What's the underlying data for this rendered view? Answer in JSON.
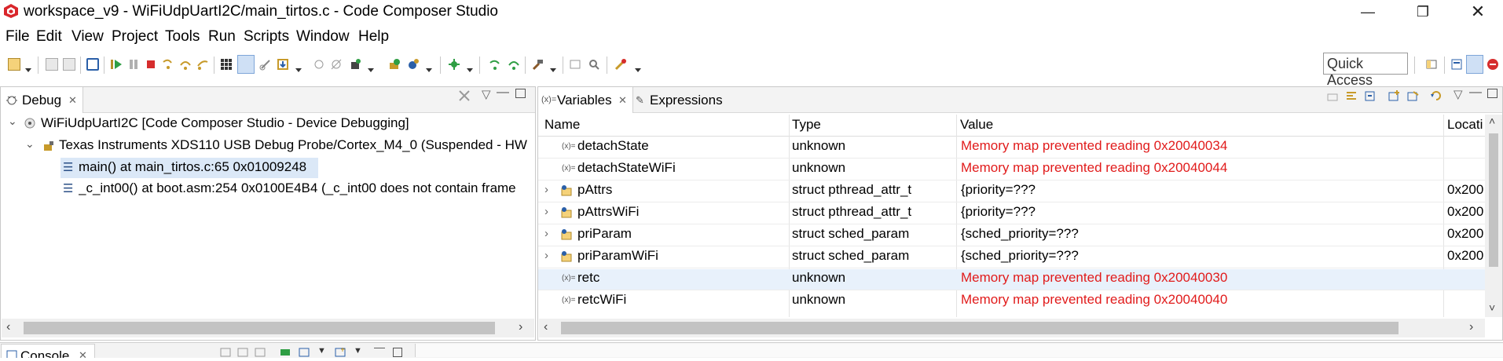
{
  "window": {
    "title": "workspace_v9 - WiFiUdpUartI2C/main_tirtos.c - Code Composer Studio"
  },
  "menu": [
    "File",
    "Edit",
    "View",
    "Project",
    "Tools",
    "Run",
    "Scripts",
    "Window",
    "Help"
  ],
  "toolbar": {
    "quick_access": "Quick Access"
  },
  "debug_view": {
    "tab_label": "Debug",
    "tree": [
      {
        "label": "WiFiUdpUartI2C [Code Composer Studio - Device Debugging]"
      },
      {
        "label": "Texas Instruments XDS110 USB Debug Probe/Cortex_M4_0 (Suspended - HW"
      },
      {
        "label": "main() at main_tirtos.c:65 0x01009248"
      },
      {
        "label": "_c_int00() at boot.asm:254 0x0100E4B4  (_c_int00 does not contain frame"
      }
    ]
  },
  "variables_view": {
    "tab_label": "Variables",
    "other_tab_label": "Expressions",
    "columns": [
      "Name",
      "Type",
      "Value",
      "Locati"
    ],
    "rows": [
      {
        "name": "detachState",
        "type": "unknown",
        "value": "Memory map prevented reading 0x20040034",
        "location": ""
      },
      {
        "name": "detachStateWiFi",
        "type": "unknown",
        "value": "Memory map prevented reading 0x20040044",
        "location": ""
      },
      {
        "name": "pAttrs",
        "type": "struct pthread_attr_t",
        "value": "{priority=???",
        "location": "0x200"
      },
      {
        "name": "pAttrsWiFi",
        "type": "struct pthread_attr_t",
        "value": "{priority=???",
        "location": "0x200"
      },
      {
        "name": "priParam",
        "type": "struct sched_param",
        "value": "{sched_priority=???",
        "location": "0x200"
      },
      {
        "name": "priParamWiFi",
        "type": "struct sched_param",
        "value": "{sched_priority=???",
        "location": "0x200"
      },
      {
        "name": "retc",
        "type": "unknown",
        "value": "Memory map prevented reading 0x20040030",
        "location": ""
      },
      {
        "name": "retcWiFi",
        "type": "unknown",
        "value": "Memory map prevented reading 0x20040040",
        "location": ""
      }
    ]
  },
  "console_view": {
    "tab_label": "Console"
  },
  "colors": {
    "error_text": "#e11b1b",
    "selection": "#dbe8f7",
    "row_highlight": "#e8f1fb"
  }
}
